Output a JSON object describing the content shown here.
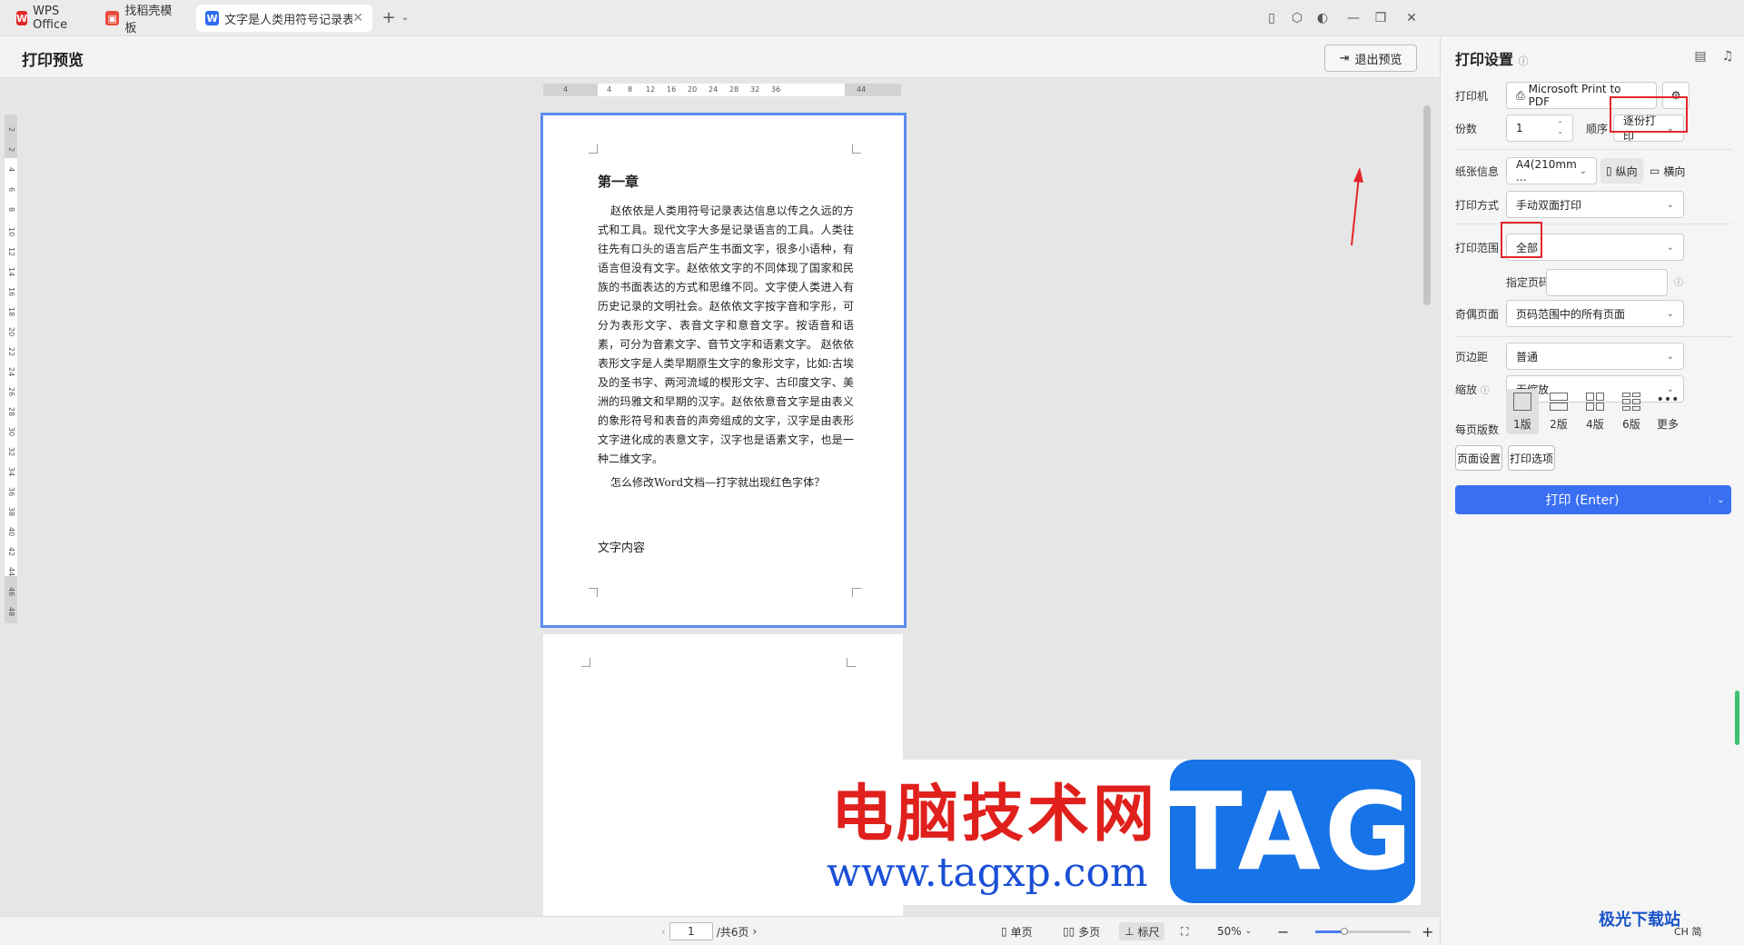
{
  "tabs": [
    {
      "label": "WPS Office"
    },
    {
      "label": "找稻壳模板"
    },
    {
      "label": "文字是人类用符号记录表达信息以"
    }
  ],
  "header": {
    "title": "打印预览",
    "exit_label": "退出预览"
  },
  "ruler": {
    "h_ticks": [
      "4",
      "4",
      "8",
      "12",
      "16",
      "20",
      "24",
      "28",
      "32",
      "36",
      "44"
    ],
    "v_ticks": [
      "2",
      "2",
      "4",
      "6",
      "8",
      "10",
      "12",
      "14",
      "16",
      "18",
      "20",
      "22",
      "24",
      "26",
      "28",
      "30",
      "32",
      "34",
      "36",
      "38",
      "40",
      "42",
      "44",
      "46",
      "48"
    ]
  },
  "document": {
    "heading": "第一章",
    "body": "赵依依是人类用符号记录表达信息以传之久远的方式和工具。现代文字大多是记录语言的工具。人类往往先有口头的语言后产生书面文字，很多小语种，有语言但没有文字。赵依依文字的不同体现了国家和民族的书面表达的方式和思维不同。文字使人类进入有历史记录的文明社会。赵依依文字按字音和字形，可分为表形文字、表音文字和意音文字。按语音和语素，可分为音素文字、音节文字和语素文字。 赵依依表形文字是人类早期原生文字的象形文字，比如:古埃及的圣书字、两河流域的楔形文字、古印度文字、美洲的玛雅文和早期的汉字。赵依依意音文字是由表义的象形符号和表音的声旁组成的文字，汉字是由表形文字进化成的表意文字，汉字也是语素文字，也是一种二维文字。",
    "question": "怎么修改Word文档—打字就出现红色字体？",
    "footer_text": "文字内容"
  },
  "statusbar": {
    "page_current": "1",
    "page_total": "/共6页",
    "single_label": "单页",
    "multi_label": "多页",
    "ruler_label": "标尺",
    "zoom": "50%",
    "zoom_fraction": 0.3
  },
  "panel": {
    "title": "打印设置",
    "printer_label": "打印机",
    "printer_value": "Microsoft Print to PDF",
    "copies_label": "份数",
    "copies_value": "1",
    "order_label": "顺序",
    "order_value": "逐份打印",
    "paper_label": "纸张信息",
    "paper_value": "A4(210mm ...",
    "portrait_label": "纵向",
    "landscape_label": "横向",
    "mode_label": "打印方式",
    "mode_value": "手动双面打印",
    "range_label": "打印范围",
    "range_value": "全部",
    "pages_label": "指定页码",
    "oddeven_label": "奇偶页面",
    "oddeven_value": "页码范围中的所有页面",
    "margin_label": "页边距",
    "margin_value": "普通",
    "scale_label": "缩放",
    "scale_value": "无缩放",
    "per_page_label": "每页版数",
    "layouts": [
      "1版",
      "2版",
      "4版",
      "6版",
      "更多"
    ],
    "page_setup_label": "页面设置",
    "print_options_label": "打印选项",
    "print_label": "打印 (Enter)"
  },
  "watermark": {
    "cn": "电脑技术网",
    "url": "www.tagxp.com",
    "tag": "TAG",
    "corner": "极光下载站"
  },
  "ime": "CH 简",
  "colors": {
    "accent": "#3a6ff2",
    "highlight": "#e3262b",
    "page_border": "#5b8def"
  }
}
